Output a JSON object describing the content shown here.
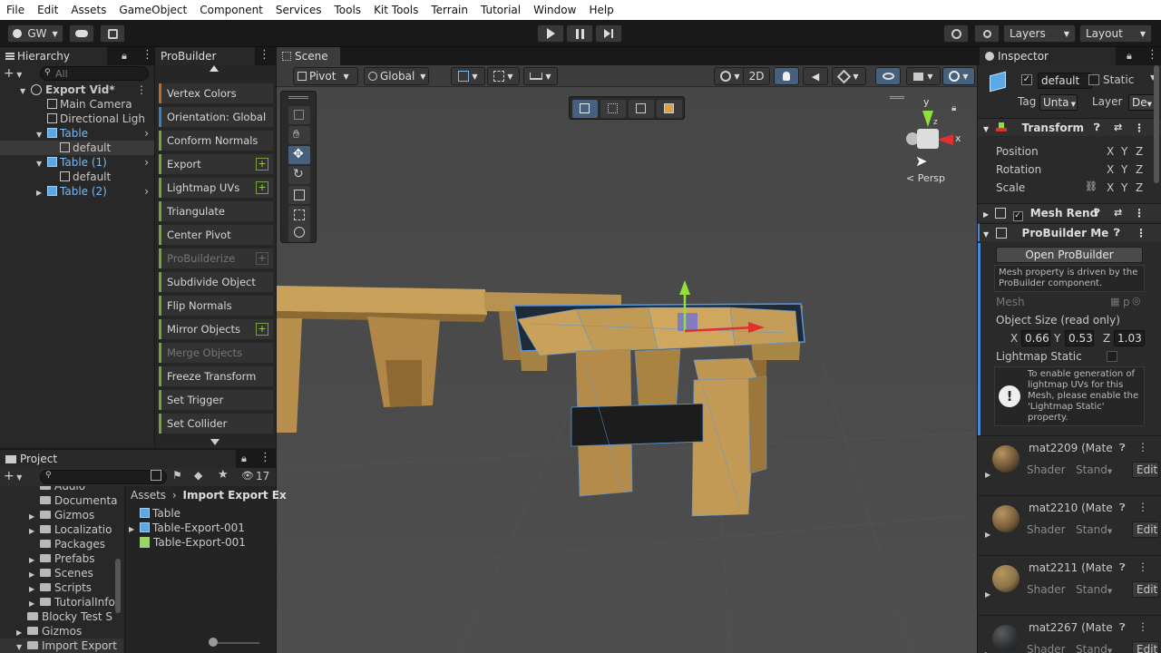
{
  "menu": [
    "File",
    "Edit",
    "Assets",
    "GameObject",
    "Component",
    "Services",
    "Tools",
    "Kit Tools",
    "Terrain",
    "Tutorial",
    "Window",
    "Help"
  ],
  "toolbar": {
    "account": "GW",
    "layers": "Layers",
    "layout": "Layout"
  },
  "hierarchy": {
    "title": "Hierarchy",
    "search_placeholder": "All",
    "items": [
      {
        "label": "Export Vid*",
        "indent": 0
      },
      {
        "label": "Main Camera",
        "indent": 1
      },
      {
        "label": "Directional Ligh",
        "indent": 1
      },
      {
        "label": "Table",
        "indent": 1
      },
      {
        "label": "default",
        "indent": 2
      },
      {
        "label": "Table (1)",
        "indent": 1
      },
      {
        "label": "default",
        "indent": 2
      },
      {
        "label": "Table (2)",
        "indent": 1
      }
    ]
  },
  "probuilder": {
    "title": "ProBuilder",
    "items": [
      {
        "label": "Vertex Colors",
        "color": "#c06a2a",
        "plus": false,
        "disabled": false
      },
      {
        "label": "Orientation: Global",
        "color": "#3a7fc0",
        "plus": false,
        "disabled": false
      },
      {
        "label": "Conform Normals",
        "color": "#7aa23a",
        "plus": false,
        "disabled": false
      },
      {
        "label": "Export",
        "color": "#7aa23a",
        "plus": true,
        "disabled": false
      },
      {
        "label": "Lightmap UVs",
        "color": "#7aa23a",
        "plus": true,
        "disabled": false
      },
      {
        "label": "Triangulate",
        "color": "#7aa23a",
        "plus": false,
        "disabled": false
      },
      {
        "label": "Center Pivot",
        "color": "#7aa23a",
        "plus": false,
        "disabled": false
      },
      {
        "label": "ProBuilderize",
        "color": "#7aa23a",
        "plus": true,
        "disabled": true
      },
      {
        "label": "Subdivide Object",
        "color": "#7aa23a",
        "plus": false,
        "disabled": false
      },
      {
        "label": "Flip Normals",
        "color": "#7aa23a",
        "plus": false,
        "disabled": false
      },
      {
        "label": "Mirror Objects",
        "color": "#7aa23a",
        "plus": true,
        "disabled": false
      },
      {
        "label": "Merge Objects",
        "color": "#7aa23a",
        "plus": false,
        "disabled": true
      },
      {
        "label": "Freeze Transform",
        "color": "#7aa23a",
        "plus": false,
        "disabled": false
      },
      {
        "label": "Set Trigger",
        "color": "#7aa23a",
        "plus": false,
        "disabled": false
      },
      {
        "label": "Set Collider",
        "color": "#7aa23a",
        "plus": false,
        "disabled": false
      }
    ],
    "plus_label": "+"
  },
  "scene": {
    "title": "Scene",
    "pivot": "Pivot",
    "global": "Global",
    "mode2d": "2D",
    "persp": "< Persp",
    "gizmo_y": "y",
    "gizmo_x": "x",
    "gizmo_z": "z"
  },
  "project": {
    "title": "Project",
    "count": "17",
    "tree": [
      "Audio",
      "Documenta",
      "Gizmos",
      "Localizatio",
      "Packages",
      "Prefabs",
      "Scenes",
      "Scripts",
      "TutorialInfo",
      "Blocky Test S",
      "Gizmos",
      "Import Export"
    ],
    "breadcrumb_root": "Assets",
    "breadcrumb_sep": "›",
    "breadcrumb_current": "Import Export Ex",
    "files": [
      "Table",
      "Table-Export-001",
      "Table-Export-001"
    ]
  },
  "inspector": {
    "title": "Inspector",
    "object_name": "default",
    "static_label": "Static",
    "tag_label": "Tag",
    "tag_value": "Unta",
    "layer_label": "Layer",
    "layer_value": "De",
    "transform": {
      "title": "Transform",
      "rows": [
        "Position",
        "Rotation",
        "Scale"
      ],
      "axes": [
        "X",
        "Y",
        "Z"
      ]
    },
    "mesh_renderer": "Mesh Rend",
    "probuilder_mesh": "ProBuilder Me",
    "open_button": "Open ProBuilder",
    "info": "Mesh property is driven by the ProBuilder component.",
    "mesh_label": "Mesh",
    "mesh_value": "p",
    "object_size_label": "Object Size (read only)",
    "size": {
      "x": "0.66",
      "y": "0.53",
      "z": "1.03"
    },
    "lightmap_static": "Lightmap Static",
    "warning": "To enable generation of lightmap UVs for this Mesh, please enable the 'Lightmap Static' property.",
    "materials": [
      {
        "name": "mat2209 (Mate",
        "shader_label": "Shader",
        "shader": "Stand",
        "edit": "Edit",
        "color": "#6e5535"
      },
      {
        "name": "mat2210 (Mate",
        "shader_label": "Shader",
        "shader": "Stand",
        "edit": "Edit",
        "color": "#7a5e3a"
      },
      {
        "name": "mat2211 (Mate",
        "shader_label": "Shader",
        "shader": "Stand",
        "edit": "Edit",
        "color": "#8a7448"
      },
      {
        "name": "mat2267 (Mate",
        "shader_label": "Shader",
        "shader": "Stand",
        "edit": "Edit",
        "color": "#2e3032"
      }
    ]
  },
  "colors": {
    "accent": "#4a8ad8",
    "selection": "#2c5d87",
    "wood": "#c19a55",
    "wire": "#5a96d8"
  }
}
